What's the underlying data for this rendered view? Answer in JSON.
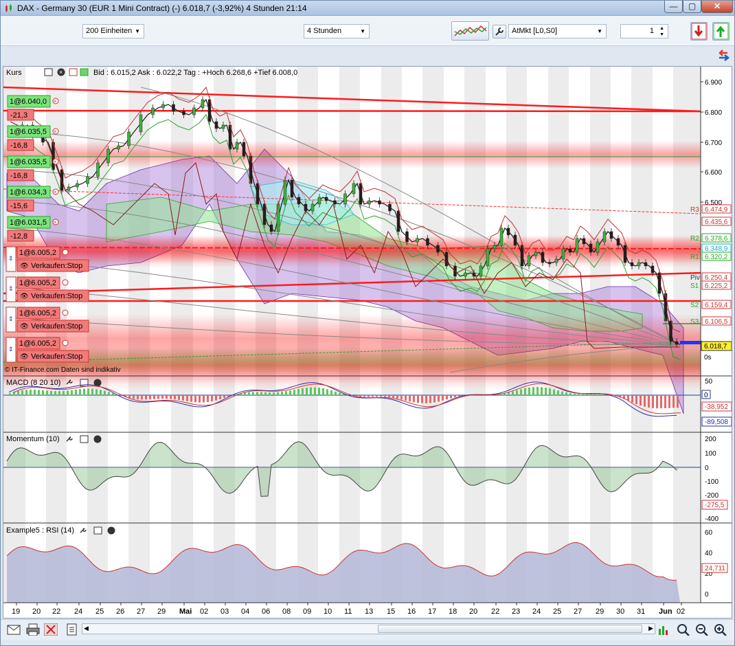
{
  "window": {
    "title": "DAX - Germany 30 (EUR 1 Mini Contract) (-)   6.018,7 (-3,92%)    4 Stunden  21:14",
    "min_glyph": "—",
    "max_glyph": "▢",
    "close_glyph": "✕"
  },
  "toolbar": {
    "units": "200 Einheiten",
    "period": "4 Stunden",
    "order_mode": "AtMkt [L0,S0]",
    "quantity": "1"
  },
  "chart": {
    "header_label": "Kurs",
    "header_info": "Bid : 6.015,2 Ask : 6.022,2  Tag : +Hoch 6.268,6 +Tief 6.008,0",
    "watermark": "© IT-Finance.com  Daten sind indikativ",
    "current_price": "6.018,7",
    "countdown": "0s",
    "price_ticks": [
      "6.900",
      "6.800",
      "6.700",
      "6.600",
      "6.500"
    ],
    "pivot_labels": [
      {
        "name": "R3",
        "value": "6.474,9"
      },
      {
        "name": "",
        "value": "6.435,6"
      },
      {
        "name": "R2",
        "value": "6.378,6"
      },
      {
        "name": "",
        "value": "6.348,9"
      },
      {
        "name": "R1",
        "value": "6.320,2"
      },
      {
        "name": "Piv",
        "value": "6.250,4"
      },
      {
        "name": "S1",
        "value": "6.225,2"
      },
      {
        "name": "S2",
        "value": "6.159,4"
      },
      {
        "name": "S3",
        "value": "6.106,5"
      }
    ],
    "orders": [
      {
        "label": "1@6.040,0",
        "pnl": "-21,3"
      },
      {
        "label": "1@6.035,5",
        "pnl": "-16,8"
      },
      {
        "label": "1@6.035,5",
        "pnl": "-16,8"
      },
      {
        "label": "1@6.034,3",
        "pnl": "-15,6"
      },
      {
        "label": "1@6.031,5",
        "pnl": "-12,8"
      }
    ],
    "stops": [
      {
        "label": "1@6.005,2",
        "action": "Verkaufen:Stop"
      },
      {
        "label": "1@6.005,2",
        "action": "Verkaufen:Stop"
      },
      {
        "label": "1@6.005,2",
        "action": "Verkaufen:Stop"
      },
      {
        "label": "1@6.005,2",
        "action": "Verkaufen:Stop"
      }
    ]
  },
  "macd": {
    "label": "MACD (8 20 10)",
    "ticks": [
      "50",
      "0"
    ],
    "values": [
      "-38,952",
      "-89,508"
    ]
  },
  "momentum": {
    "label": "Momentum (10)",
    "ticks": [
      "200",
      "100",
      "0",
      "-100",
      "-200",
      "-400"
    ],
    "value": "-275,5"
  },
  "rsi": {
    "label": "Example5 : RSI (14)",
    "ticks": [
      "60",
      "40",
      "20",
      "0"
    ],
    "value": "24,711"
  },
  "xaxis": [
    "19",
    "20",
    "22",
    "24",
    "25",
    "26",
    "27",
    "29",
    "Mai",
    "02",
    "03",
    "04",
    "06",
    "08",
    "09",
    "10",
    "11",
    "13",
    "15",
    "16",
    "17",
    "18",
    "20",
    "22",
    "23",
    "24",
    "25",
    "27",
    "29",
    "30",
    "31",
    "Jun",
    "02"
  ],
  "colors": {
    "accent": "#ff0000",
    "order_green": "#7ce37c",
    "stop_red": "#f27a7a",
    "macd_pos": "#59c959",
    "macd_neg": "#e56868",
    "rsi_fill": "#b8bbd9"
  }
}
